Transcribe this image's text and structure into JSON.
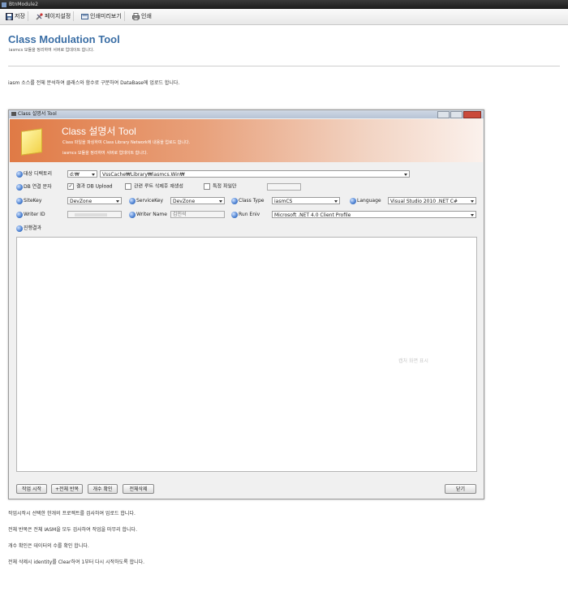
{
  "window": {
    "title": "BtnModule2"
  },
  "toolbar": {
    "save": "저장",
    "page_setup": "페이지설정",
    "print_preview": "인쇄미리보기",
    "print": "인쇄"
  },
  "page": {
    "title": "Class Modulation Tool",
    "subtitle": "iasmcs 모듈을 정리하여 서버로 업데이트 합니다.",
    "description": "iasm 소스를 전체 분석하여 클래스와 함수로 구분하여 DataBase에 업로드 합니다."
  },
  "dialog": {
    "title": "Class 설명서 Tool",
    "banner_title": "Class 설명서 Tool",
    "banner_sub1": "Class 파일을 파싱하여 Class Library Network에 내용을 업로드 합니다.",
    "banner_sub2": "iasmcs 모듈을 정리하여 서버로 업데이트 합니다.",
    "target_dir_label": "대상 디렉토리",
    "drive": "d:₩",
    "path": "VssCache₩Library₩iasmcs.Win₩",
    "db_conn_label": "DB 연결 문자",
    "chk_db_upload": "결과 DB Upload",
    "chk_regen": "관련 루트 삭제후 재생성",
    "chk_specific": "특정 파일만",
    "sitekey_label": "SiteKey",
    "sitekey_value": "DevZone",
    "servicekey_label": "ServiceKey",
    "servicekey_value": "DevZone",
    "classtype_label": "Class Type",
    "classtype_value": "iasmCS",
    "language_label": "Language",
    "language_value": "Visual Studio 2010 .NET C#",
    "writerid_label": "Writer ID",
    "writername_label": "Writer Name",
    "writername_value": "김민석",
    "runenv_label": "Run Eniv",
    "runenv_value": "Microsoft .NET 4.0 Client Profile",
    "progress_label": "진행결과",
    "watermark": "캡처 화면 표시",
    "btn_start": "작업 시작",
    "btn_repeat": "+전체 반복",
    "btn_count": "개수 확인",
    "btn_delete": "전체삭제",
    "btn_close": "닫기"
  },
  "notes": [
    "작업시작시 선택한 한개의 프로젝트를 검사하여 업로드 합니다.",
    "전체 반복은 전체 IASM을 모두 검사하여 작업을 마무리 합니다.",
    "개수 확인은 데이터의 수를 확인 합니다.",
    "전체 삭제시 identity를 Clear하여 1부터 다시 시작하도록 합니다."
  ]
}
